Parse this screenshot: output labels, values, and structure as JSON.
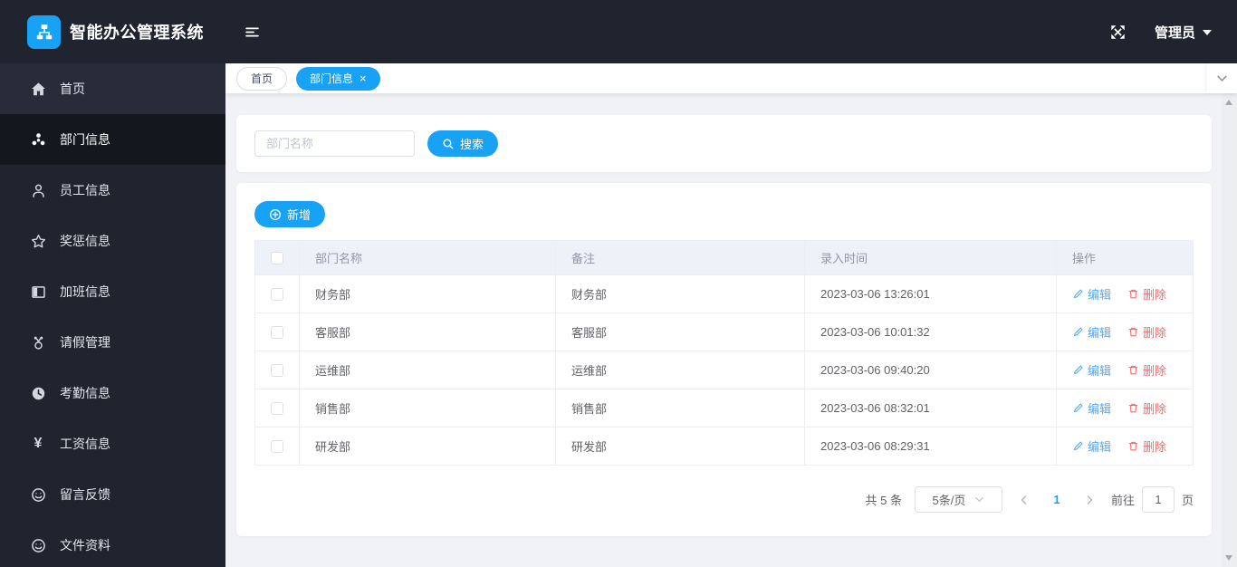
{
  "app": {
    "title": "智能办公管理系统"
  },
  "header": {
    "user_label": "管理员"
  },
  "sidebar": {
    "items": [
      {
        "label": "首页"
      },
      {
        "label": "部门信息"
      },
      {
        "label": "员工信息"
      },
      {
        "label": "奖惩信息"
      },
      {
        "label": "加班信息"
      },
      {
        "label": "请假管理"
      },
      {
        "label": "考勤信息"
      },
      {
        "label": "工资信息"
      },
      {
        "label": "留言反馈"
      },
      {
        "label": "文件资料"
      }
    ]
  },
  "tabs": {
    "home": "首页",
    "active": "部门信息",
    "close_glyph": "×"
  },
  "search": {
    "placeholder": "部门名称",
    "button_label": "搜索"
  },
  "toolbar": {
    "add_label": "新增"
  },
  "table": {
    "columns": {
      "name": "部门名称",
      "remark": "备注",
      "time": "录入时间",
      "ops": "操作"
    },
    "rows": [
      {
        "name": "财务部",
        "remark": "财务部",
        "time": "2023-03-06 13:26:01"
      },
      {
        "name": "客服部",
        "remark": "客服部",
        "time": "2023-03-06 10:01:32"
      },
      {
        "name": "运维部",
        "remark": "运维部",
        "time": "2023-03-06 09:40:20"
      },
      {
        "name": "销售部",
        "remark": "销售部",
        "time": "2023-03-06 08:32:01"
      },
      {
        "name": "研发部",
        "remark": "研发部",
        "time": "2023-03-06 08:29:31"
      }
    ],
    "edit_label": "编辑",
    "delete_label": "删除"
  },
  "pagination": {
    "total": "共 5 条",
    "page_size": "5条/页",
    "current_page": "1",
    "goto_label": "前往",
    "goto_value": "1",
    "page_unit": "页"
  },
  "colors": {
    "accent": "#17a2f5",
    "danger": "#f56c6c",
    "edit_link": "#53a8f7",
    "dark_bg": "#20242e",
    "table_header_bg": "#edf2f9"
  }
}
